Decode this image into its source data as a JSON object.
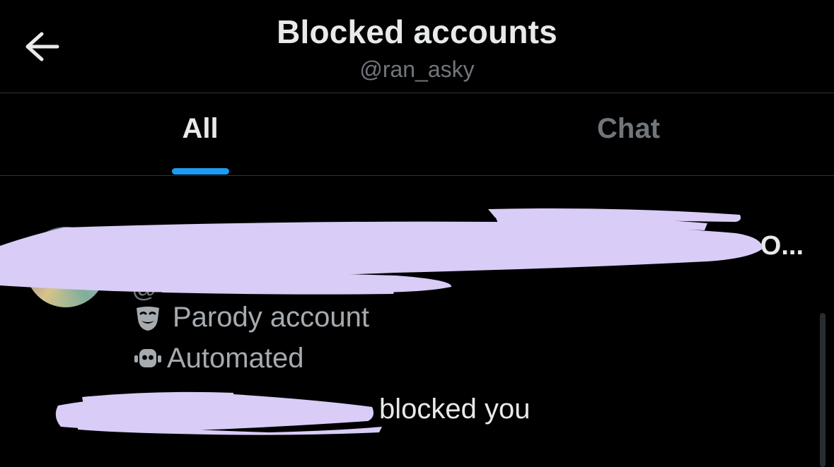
{
  "header": {
    "title": "Blocked accounts",
    "subtitle": "@ran_asky",
    "back_icon": "arrow-left-icon"
  },
  "tabs": [
    {
      "label": "All",
      "selected": true
    },
    {
      "label": "Chat",
      "selected": false
    }
  ],
  "account": {
    "name_tail": "O...",
    "handle_prefix": "@",
    "labels": [
      {
        "icon": "theater-mask-icon",
        "text": "Parody account"
      },
      {
        "icon": "robot-icon",
        "text": "Automated"
      }
    ],
    "blocked_text": "blocked you",
    "redacted": true
  },
  "colors": {
    "background": "#000000",
    "accent": "#1d9bf0",
    "redaction": "#d9ccf7",
    "muted_text": "#71767b"
  }
}
